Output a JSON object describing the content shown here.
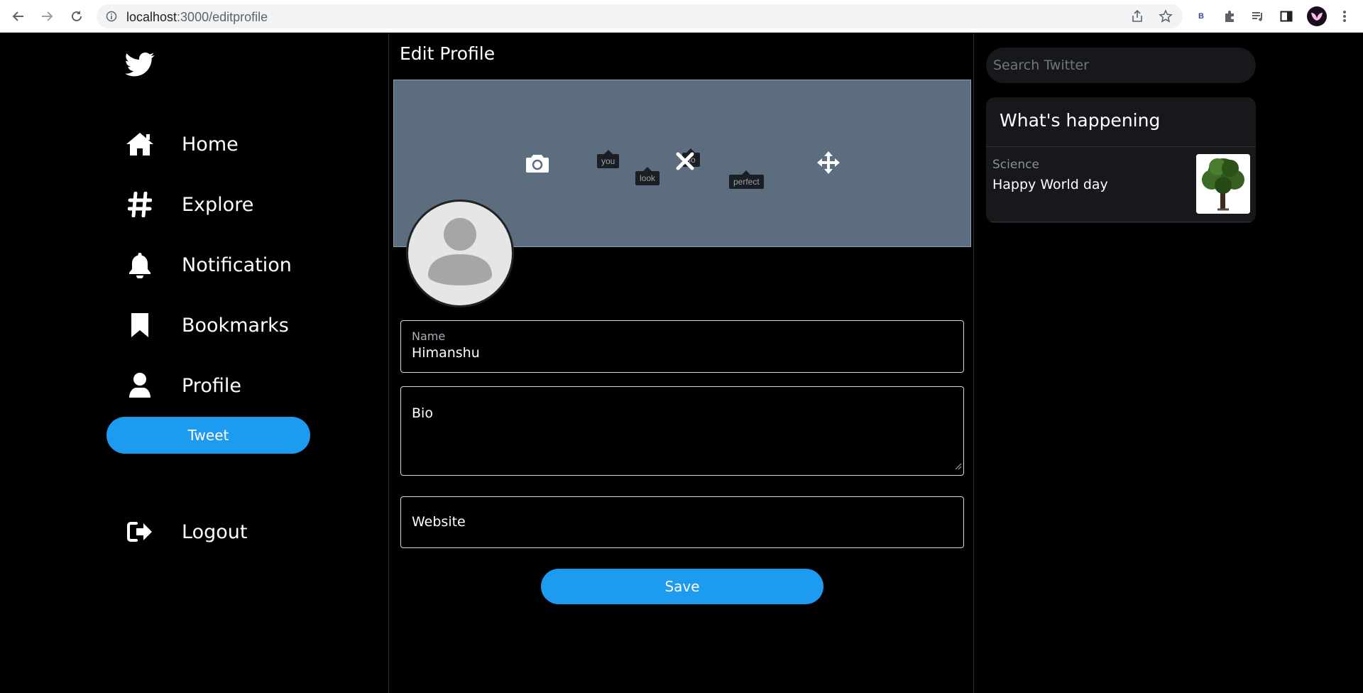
{
  "browser": {
    "url_host": "localhost",
    "url_path": ":3000/editprofile",
    "extension_badge": "B"
  },
  "sidebar": {
    "items": [
      {
        "label": "Home",
        "icon": "home-icon"
      },
      {
        "label": "Explore",
        "icon": "hashtag-icon"
      },
      {
        "label": "Notification",
        "icon": "bell-icon"
      },
      {
        "label": "Bookmarks",
        "icon": "bookmark-icon"
      },
      {
        "label": "Profile",
        "icon": "user-icon"
      }
    ],
    "tweet_label": "Tweet",
    "logout_label": "Logout"
  },
  "main": {
    "title": "Edit Profile",
    "banner_tags": [
      "you",
      "look",
      "so",
      "perfect"
    ],
    "name_label": "Name",
    "name_value": "Himanshu",
    "bio_placeholder": "Bio",
    "website_placeholder": "Website",
    "save_label": "Save"
  },
  "right": {
    "search_placeholder": "Search Twitter",
    "trends_title": "What's happening",
    "trend": {
      "category": "Science",
      "title": "Happy World day"
    }
  },
  "colors": {
    "accent": "#1d9bf0",
    "banner": "#5b6d7e",
    "background": "#000000",
    "panel": "#16181c"
  }
}
